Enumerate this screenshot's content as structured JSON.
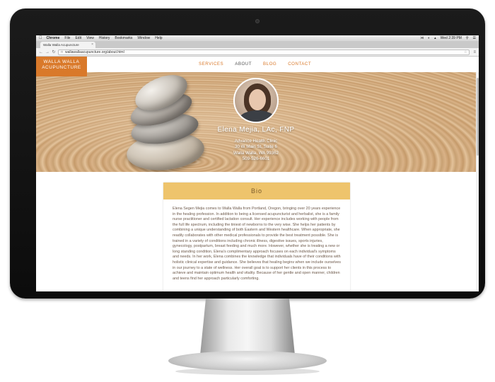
{
  "mac_menubar": {
    "items": [
      "Chrome",
      "File",
      "Edit",
      "View",
      "History",
      "Bookmarks",
      "Window",
      "Help"
    ],
    "clock": "Wed 2:39 PM"
  },
  "browser": {
    "tab_title": "Walla Walla Acupuncture",
    "url": "wallawallaacupuncture.org/about.html"
  },
  "site": {
    "logo_line1": "WALLA WALLA",
    "logo_line2": "ACUPUNCTURE",
    "nav": [
      {
        "label": "SERVICES",
        "active": false
      },
      {
        "label": "ABOUT",
        "active": true
      },
      {
        "label": "BLOG",
        "active": false
      },
      {
        "label": "CONTACT",
        "active": false
      }
    ],
    "name": "Elena Mejia, LAc, FNP",
    "address_lines": [
      "Advance Health Clinic",
      "30 W Main St, Suite 6",
      "Walla Walla, WA 99362",
      "509-526-6601"
    ],
    "bio_heading": "Bio",
    "bio_text": "Elena Segen Mejia comes to Walla Walla from Portland, Oregon, bringing over 20 years experience in the healing profession. In addition to being a licensed acupuncturist and herbalist, she is a family nurse practitioner and certified lactation consult. Her experience includes working with people from the full life spectrum, including the tiniest of newborns to the very wise. She helps her patients by combining a unique understanding of both Eastern and Western healthcare. When appropriate, she readily collaborates with other medical professionals to provide the best treatment possible. She is trained in a variety of conditions including chronic illness, digestive issues, sports injuries, gynecology, postpartum, breast feeding and much more. However, whether she is treating a new or long standing condition, Elena's complimentary approach focuses on each individual's symptoms and needs. In her work, Elena combines the knowledge that individuals have of their conditions with holistic clinical expertise and guidance. She believes that healing begins when we include ourselves in our journey to a state of wellness. Her overall goal is to support her clients in this process to achieve and maintain optimum health and vitality. Because of her gentle and open manner, children and teens find her approach particularly comforting."
  },
  "colors": {
    "brand_orange": "#d9792a",
    "bio_header": "#eec46c"
  }
}
